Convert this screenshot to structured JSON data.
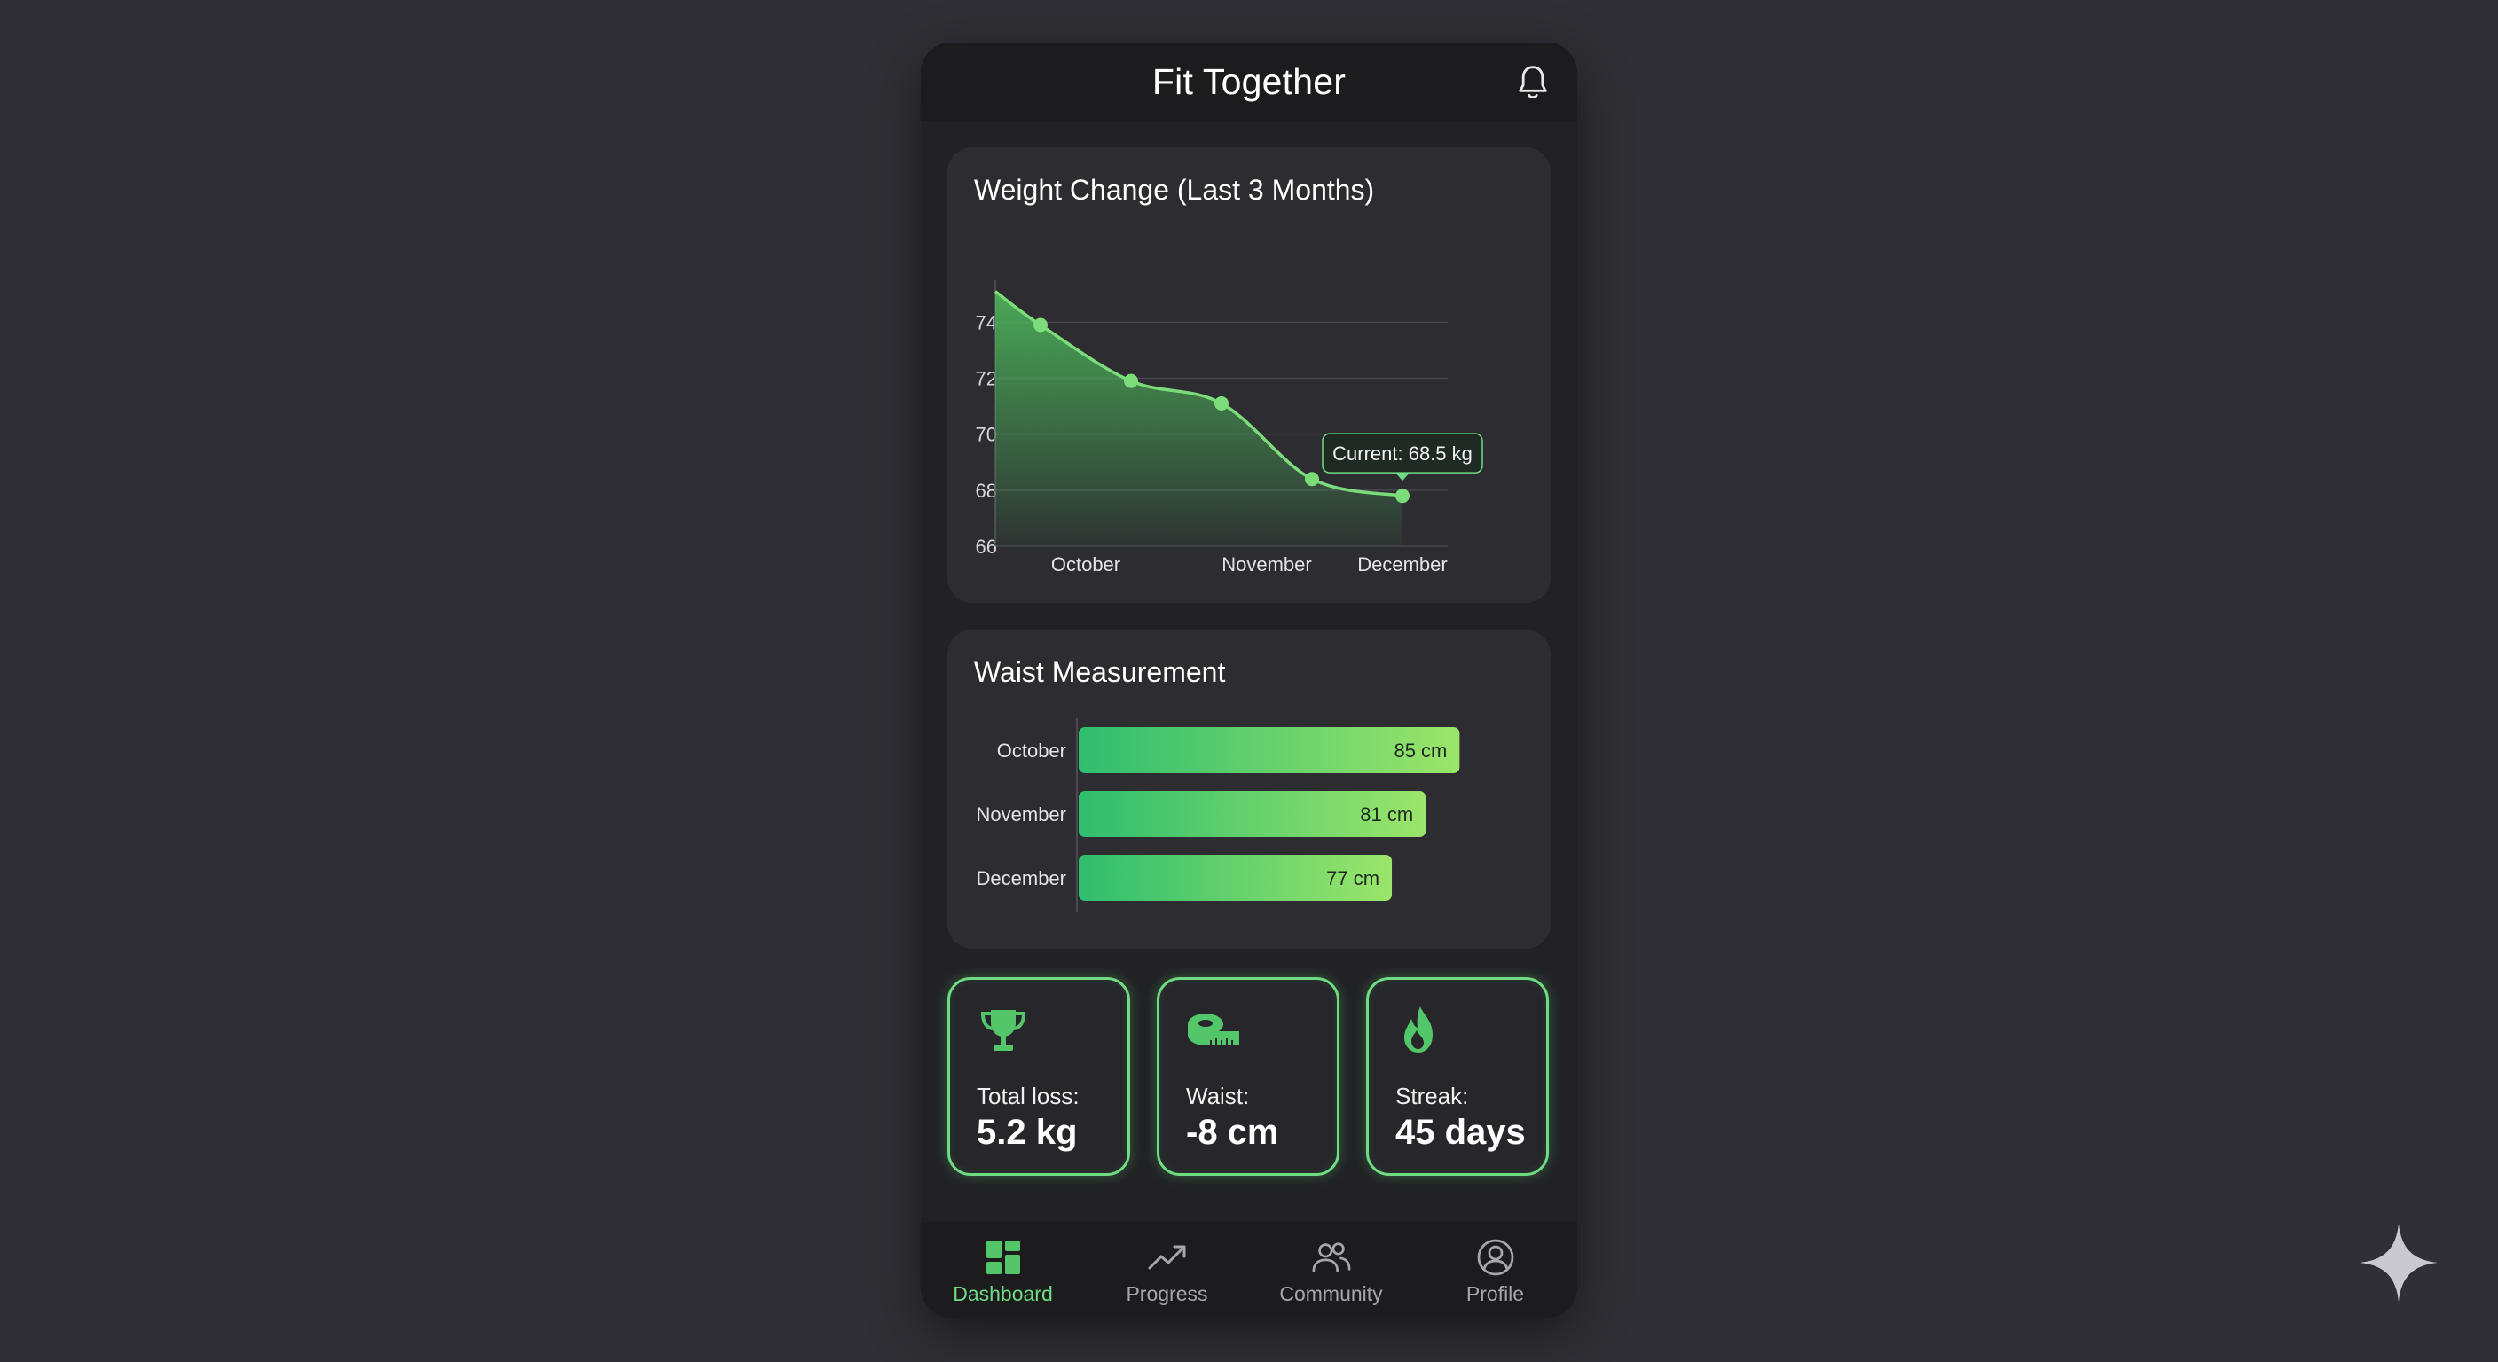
{
  "header": {
    "title": "Fit Together",
    "bell_icon": "bell-icon"
  },
  "weight_card": {
    "title": "Weight Change (Last 3 Months)",
    "tooltip": "Current: 68.5 kg"
  },
  "waist_card": {
    "title": "Waist Measurement"
  },
  "chart_data": [
    {
      "type": "area",
      "title": "Weight Change (Last 3 Months)",
      "y_ticks": [
        "74",
        "72",
        "70",
        "68",
        "66"
      ],
      "x_ticks": [
        "October",
        "November",
        "December"
      ],
      "ylim": [
        66,
        75.5
      ],
      "grid": true,
      "line_color": "#7ddc7a",
      "series": [
        {
          "x": [
            0.0,
            0.25,
            0.75,
            1.25,
            1.75,
            2.25
          ],
          "values": [
            75.1,
            73.9,
            71.9,
            71.1,
            68.4,
            67.8
          ]
        }
      ],
      "marker_indices": [
        1,
        2,
        3,
        4,
        5
      ],
      "annotation": "Current: 68.5 kg"
    },
    {
      "type": "bar",
      "orientation": "horizontal",
      "title": "Waist Measurement",
      "categories": [
        "October",
        "November",
        "December"
      ],
      "values": [
        85,
        81,
        77
      ],
      "value_labels": [
        "85 cm",
        "81 cm",
        "77 cm"
      ],
      "xlim": [
        40,
        88
      ],
      "colors": [
        "#2fbd6f",
        "#9be56a"
      ]
    }
  ],
  "stats": [
    {
      "icon": "trophy-icon",
      "label": "Total loss:",
      "value": "5.2 kg"
    },
    {
      "icon": "tape-measure-icon",
      "label": "Waist:",
      "value": "-8 cm"
    },
    {
      "icon": "flame-icon",
      "label": "Streak:",
      "value": "45 days"
    }
  ],
  "nav": [
    {
      "icon": "dashboard-icon",
      "label": "Dashboard",
      "active": true
    },
    {
      "icon": "trending-up-icon",
      "label": "Progress",
      "active": false
    },
    {
      "icon": "users-icon",
      "label": "Community",
      "active": false
    },
    {
      "icon": "user-circle-icon",
      "label": "Profile",
      "active": false
    }
  ],
  "colors": {
    "accent": "#6fdc83",
    "card": "#2c2c31",
    "background": "#2f2f35"
  }
}
